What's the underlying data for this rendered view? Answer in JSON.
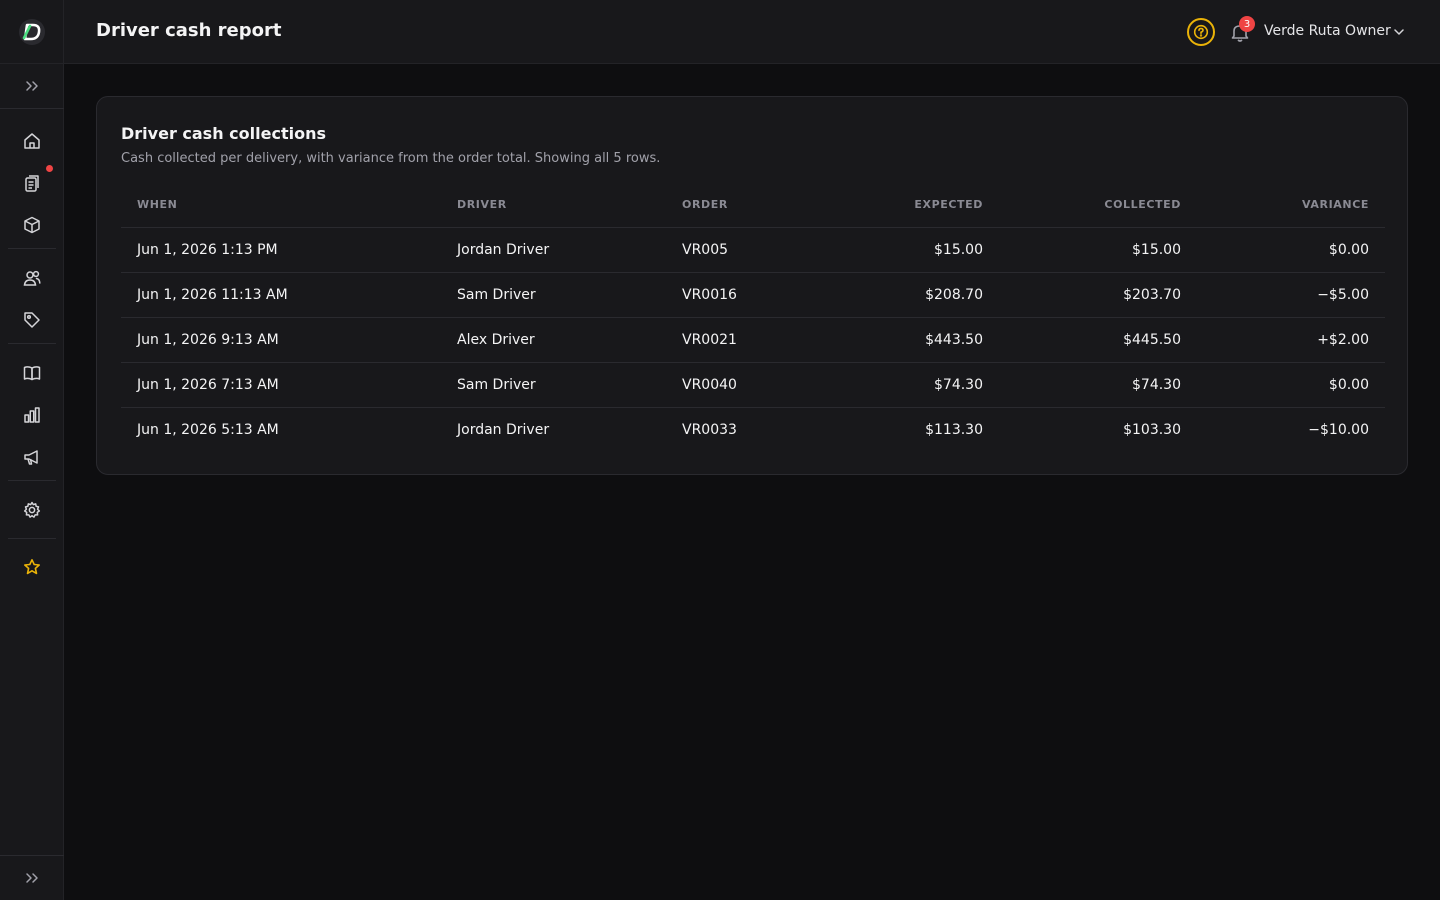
{
  "header": {
    "title": "Driver cash report",
    "user_name": "Verde Ruta Owner",
    "notification_count": "3"
  },
  "sidebar": {
    "items": [
      {
        "name": "home-icon"
      },
      {
        "name": "orders-icon"
      },
      {
        "name": "products-icon"
      },
      {
        "name": "customers-icon"
      },
      {
        "name": "tags-icon"
      },
      {
        "name": "catalog-icon"
      },
      {
        "name": "reports-icon"
      },
      {
        "name": "marketing-icon"
      },
      {
        "name": "settings-icon"
      },
      {
        "name": "favorites-icon"
      }
    ]
  },
  "card": {
    "title": "Driver cash collections",
    "subtitle": "Cash collected per delivery, with variance from the order total. Showing all 5 rows."
  },
  "table": {
    "columns": [
      "WHEN",
      "DRIVER",
      "ORDER",
      "EXPECTED",
      "COLLECTED",
      "VARIANCE"
    ],
    "rows": [
      {
        "when": "Jun 1, 2026 1:13 PM",
        "driver": "Jordan Driver",
        "order": "VR005",
        "expected": "$15.00",
        "collected": "$15.00",
        "variance": "$0.00",
        "tone": "zero"
      },
      {
        "when": "Jun 1, 2026 11:13 AM",
        "driver": "Sam Driver",
        "order": "VR0016",
        "expected": "$208.70",
        "collected": "$203.70",
        "variance": "−$5.00",
        "tone": "neg"
      },
      {
        "when": "Jun 1, 2026 9:13 AM",
        "driver": "Alex Driver",
        "order": "VR0021",
        "expected": "$443.50",
        "collected": "$445.50",
        "variance": "+$2.00",
        "tone": "pos"
      },
      {
        "when": "Jun 1, 2026 7:13 AM",
        "driver": "Sam Driver",
        "order": "VR0040",
        "expected": "$74.30",
        "collected": "$74.30",
        "variance": "$0.00",
        "tone": "zero"
      },
      {
        "when": "Jun 1, 2026 5:13 AM",
        "driver": "Jordan Driver",
        "order": "VR0033",
        "expected": "$113.30",
        "collected": "$103.30",
        "variance": "−$10.00",
        "tone": "neg"
      }
    ]
  },
  "colors": {
    "background": "#0e0e10",
    "surface": "#18181b",
    "accent_help": "#eab308",
    "badge": "#ef4444",
    "positive": "#22c55e",
    "negative": "#ef4444",
    "favorite_star": "#eab308",
    "logo": "#4ade80"
  }
}
